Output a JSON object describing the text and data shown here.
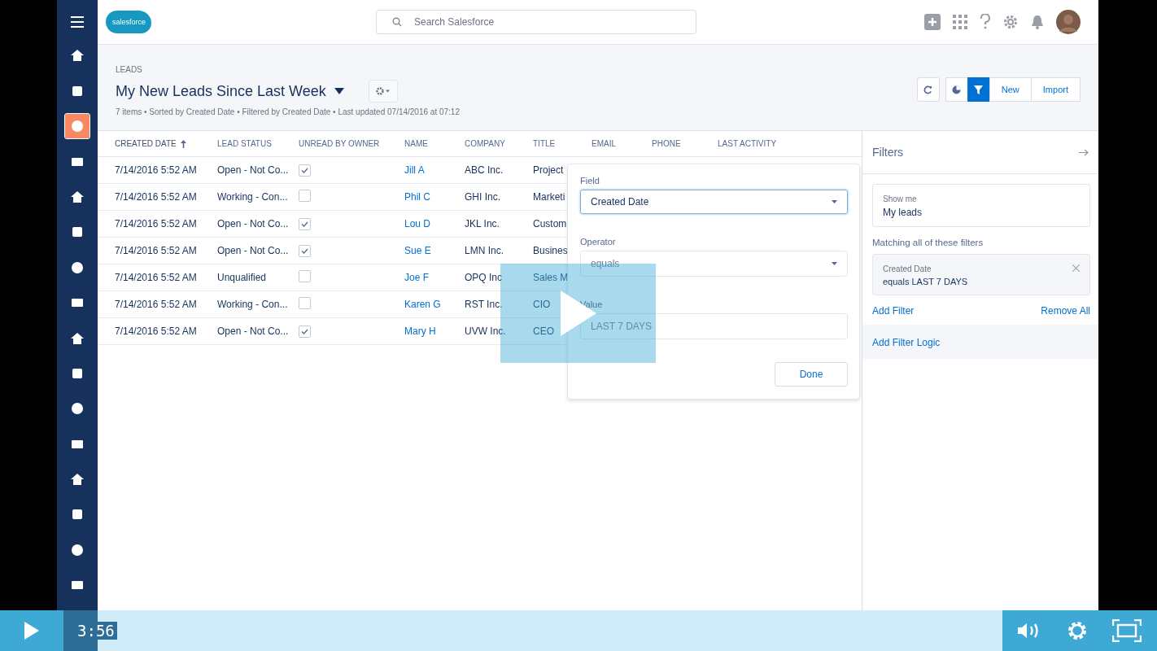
{
  "logo": {
    "text": "salesforce"
  },
  "search": {
    "placeholder": "Search Salesforce"
  },
  "nav_items": [
    {
      "selected": false
    },
    {
      "selected": false
    },
    {
      "selected": true
    },
    {
      "selected": false
    },
    {
      "selected": false
    },
    {
      "selected": false
    },
    {
      "selected": false
    },
    {
      "selected": false
    },
    {
      "selected": false
    },
    {
      "selected": false
    },
    {
      "selected": false
    },
    {
      "selected": false
    },
    {
      "selected": false
    },
    {
      "selected": false
    },
    {
      "selected": false
    },
    {
      "selected": false
    }
  ],
  "list_header": {
    "object": "LEADS",
    "title": "My New Leads Since Last Week",
    "meta": "7 items • Sorted by Created Date • Filtered by Created Date • Last updated 07/14/2016 at 07:12"
  },
  "actions": [
    {
      "kind": "refresh",
      "selected": false
    },
    {
      "kind": "chart",
      "selected": false
    },
    {
      "kind": "filter",
      "selected": true
    },
    {
      "kind": "text",
      "label": "New",
      "selected": false
    },
    {
      "kind": "text",
      "label": "Import",
      "selected": false
    }
  ],
  "table": {
    "columns": [
      {
        "label": "CREATED DATE",
        "sorted": true
      },
      {
        "label": "LEAD STATUS",
        "sorted": false
      },
      {
        "label": "UNREAD BY OWNER",
        "sorted": false
      },
      {
        "label": "NAME",
        "sorted": false
      },
      {
        "label": "COMPANY",
        "sorted": false
      },
      {
        "label": "TITLE",
        "sorted": false
      },
      {
        "label": "EMAIL",
        "sorted": false
      },
      {
        "label": "PHONE",
        "sorted": false
      },
      {
        "label": "LAST ACTIVITY",
        "sorted": false
      }
    ],
    "rows": [
      {
        "created": "7/14/2016 5:52 AM",
        "status": "Open - Not Co...",
        "unread": true,
        "name": "Jill A",
        "company": "ABC Inc.",
        "title": "Project"
      },
      {
        "created": "7/14/2016 5:52 AM",
        "status": "Working - Con...",
        "unread": false,
        "name": "Phil C",
        "company": "GHI Inc.",
        "title": "Marketi"
      },
      {
        "created": "7/14/2016 5:52 AM",
        "status": "Open - Not Co...",
        "unread": true,
        "name": "Lou D",
        "company": "JKL Inc.",
        "title": "Custom"
      },
      {
        "created": "7/14/2016 5:52 AM",
        "status": "Open - Not Co...",
        "unread": true,
        "name": "Sue E",
        "company": "LMN Inc.",
        "title": "Busines"
      },
      {
        "created": "7/14/2016 5:52 AM",
        "status": "Unqualified",
        "unread": false,
        "name": "Joe F",
        "company": "OPQ Inc",
        "title": "Sales M"
      },
      {
        "created": "7/14/2016 5:52 AM",
        "status": "Working - Con...",
        "unread": false,
        "name": "Karen G",
        "company": "RST Inc.",
        "title": "CIO"
      },
      {
        "created": "7/14/2016 5:52 AM",
        "status": "Open - Not Co...",
        "unread": true,
        "name": "Mary H",
        "company": "UVW Inc.",
        "title": "CEO"
      }
    ]
  },
  "popover": {
    "field_label": "Field",
    "field_value": "Created Date",
    "operator_label": "Operator",
    "operator_value": "equals",
    "value_label": "Value",
    "value": "LAST 7 DAYS",
    "done": "Done"
  },
  "filters": {
    "title": "Filters",
    "show_me_label": "Show me",
    "show_me_value": "My leads",
    "matching": "Matching all of these filters",
    "items": [
      {
        "field": "Created Date",
        "condition": "equals  LAST 7 DAYS"
      }
    ],
    "add_filter": "Add Filter",
    "remove_all": "Remove All",
    "add_logic": "Add Filter Logic"
  },
  "player": {
    "time": "3:56",
    "progress": {
      "level": 0.036
    }
  }
}
